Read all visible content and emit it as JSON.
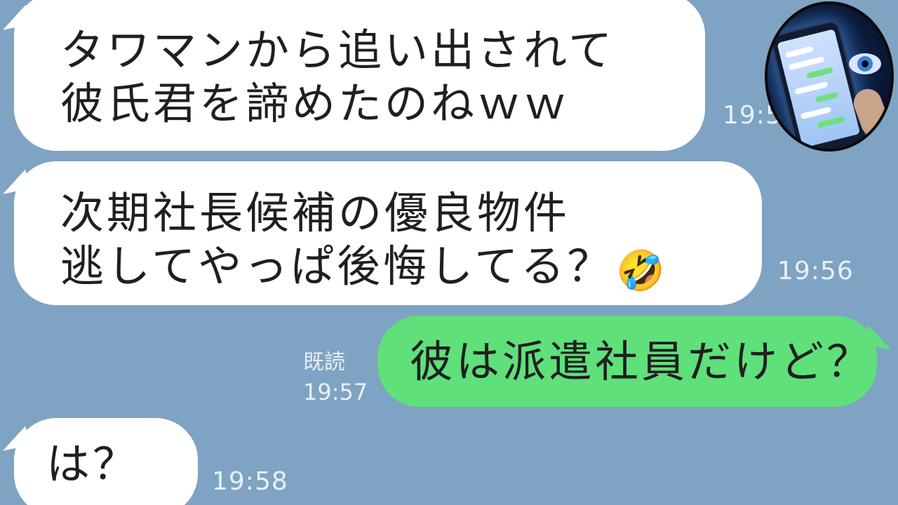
{
  "messages": [
    {
      "side": "in",
      "lines": [
        "タワマンから追い出されて",
        "彼氏君を諦めたのねｗｗ"
      ],
      "time": "19:5"
    },
    {
      "side": "in",
      "lines": [
        "次期社長候補の優良物件",
        "逃してやっぱ後悔してる？"
      ],
      "emoji": "🤣",
      "time": "19:56"
    },
    {
      "side": "out",
      "lines": [
        "彼は派遣社員だけど？"
      ],
      "read": "既読",
      "time": "19:57"
    },
    {
      "side": "in",
      "lines": [
        "は？"
      ],
      "time": "19:58"
    }
  ],
  "thumbnail": {
    "icon": "spy-phone-thumbnail-icon"
  },
  "colors": {
    "background": "#7fa3c3",
    "incoming_bubble": "#ffffff",
    "outgoing_bubble": "#5fe07a",
    "timestamp": "#e9f0f7"
  }
}
